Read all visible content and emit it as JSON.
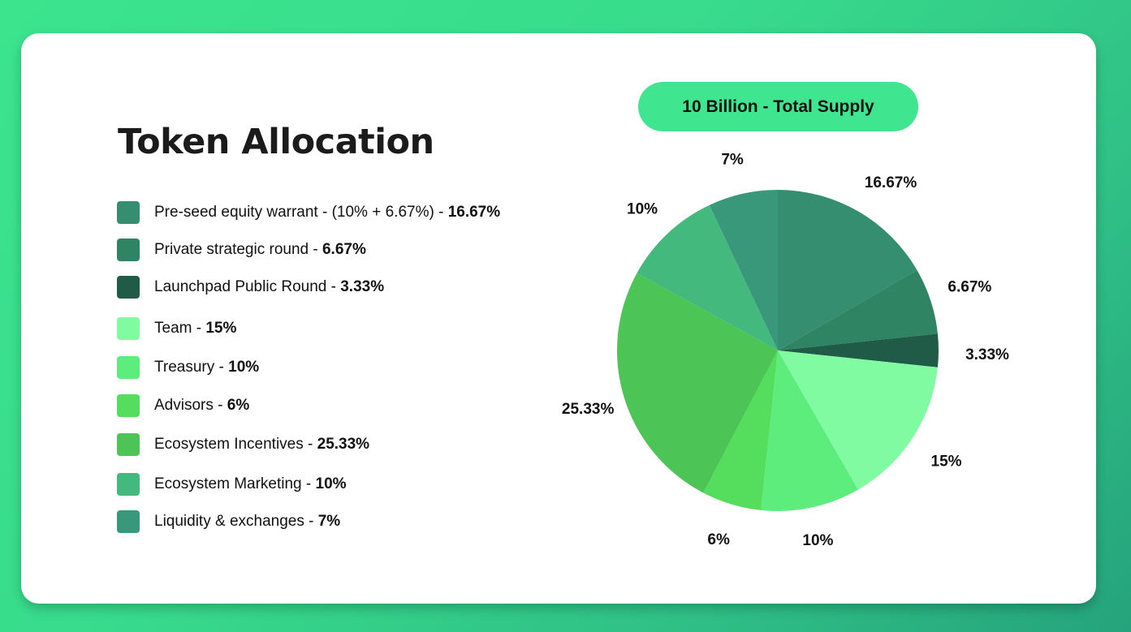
{
  "title": "Token Allocation",
  "supply_badge": "10 Billion - Total Supply",
  "legend": [
    {
      "label": "Pre-seed equity warrant - (10% + 6.67%) - ",
      "value": "16.67%",
      "color": "#368e70"
    },
    {
      "label": "Private strategic round - ",
      "value": "6.67%",
      "color": "#2f8464"
    },
    {
      "label": "Launchpad Public Round - ",
      "value": "3.33%",
      "color": "#1f5b46"
    },
    {
      "label": "Team - ",
      "value": "15%",
      "color": "#80fba2"
    },
    {
      "label": "Treasury - ",
      "value": "10%",
      "color": "#5ced7d"
    },
    {
      "label": "Advisors - ",
      "value": "6%",
      "color": "#55de5d"
    },
    {
      "label": "Ecosystem Incentives - ",
      "value": "25.33%",
      "color": "#4cc456"
    },
    {
      "label": "Ecosystem Marketing - ",
      "value": "10%",
      "color": "#43b97e"
    },
    {
      "label": "Liquidity & exchanges - ",
      "value": "7%",
      "color": "#3a987a"
    }
  ],
  "chart_data": {
    "type": "pie",
    "title": "10 Billion - Total Supply",
    "start": "12 o'clock",
    "direction": "clockwise",
    "legend_position": "left",
    "slices": [
      {
        "name": "Pre-seed equity warrant",
        "value": 16.67,
        "label": "16.67%",
        "color": "#368e70"
      },
      {
        "name": "Private strategic round",
        "value": 6.67,
        "label": "6.67%",
        "color": "#2f8464"
      },
      {
        "name": "Launchpad Public Round",
        "value": 3.33,
        "label": "3.33%",
        "color": "#1f5b46"
      },
      {
        "name": "Team",
        "value": 15,
        "label": "15%",
        "color": "#80fba2"
      },
      {
        "name": "Treasury",
        "value": 10,
        "label": "10%",
        "color": "#5ced7d"
      },
      {
        "name": "Advisors",
        "value": 6,
        "label": "6%",
        "color": "#55de5d"
      },
      {
        "name": "Ecosystem Incentives",
        "value": 25.33,
        "label": "25.33%",
        "color": "#4cc456"
      },
      {
        "name": "Ecosystem Marketing",
        "value": 10,
        "label": "10%",
        "color": "#43b97e"
      },
      {
        "name": "Liquidity & exchanges",
        "value": 7,
        "label": "7%",
        "color": "#3a987a"
      }
    ]
  }
}
